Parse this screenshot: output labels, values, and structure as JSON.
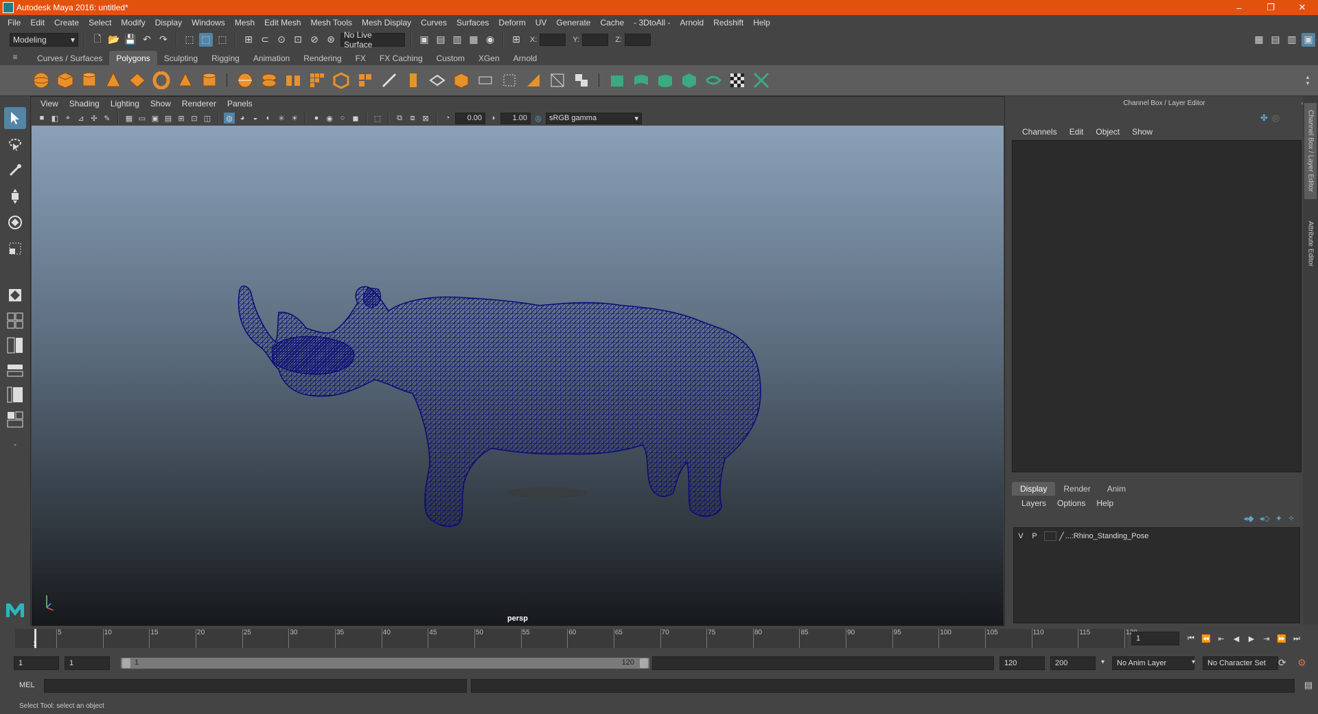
{
  "window": {
    "title": "Autodesk Maya 2016: untitled*",
    "controls": [
      "–",
      "❐",
      "✕"
    ]
  },
  "menubar": [
    "File",
    "Edit",
    "Create",
    "Select",
    "Modify",
    "Display",
    "Windows",
    "Mesh",
    "Edit Mesh",
    "Mesh Tools",
    "Mesh Display",
    "Curves",
    "Surfaces",
    "Deform",
    "UV",
    "Generate",
    "Cache",
    "- 3DtoAll -",
    "Arnold",
    "Redshift",
    "Help"
  ],
  "statusline": {
    "menuset": "Modeling",
    "live_surface": "No Live Surface",
    "x_label": "X:",
    "y_label": "Y:",
    "z_label": "Z:"
  },
  "shelf": {
    "tabs": [
      "Curves / Surfaces",
      "Polygons",
      "Sculpting",
      "Rigging",
      "Animation",
      "Rendering",
      "FX",
      "FX Caching",
      "Custom",
      "XGen",
      "Arnold"
    ],
    "active_tab": "Polygons"
  },
  "viewport": {
    "panel_menu": [
      "View",
      "Shading",
      "Lighting",
      "Show",
      "Renderer",
      "Panels"
    ],
    "exposure": "0.00",
    "gamma": "1.00",
    "color_space": "sRGB gamma",
    "camera": "persp",
    "wire_color": "#0a0a78"
  },
  "channel_box": {
    "header": "Channel Box / Layer Editor",
    "menu": [
      "Channels",
      "Edit",
      "Object",
      "Show"
    ]
  },
  "layer_editor": {
    "tabs": [
      "Display",
      "Render",
      "Anim"
    ],
    "active_tab": "Display",
    "menu": [
      "Layers",
      "Options",
      "Help"
    ],
    "layer": {
      "v": "V",
      "p": "P",
      "name": "...:Rhino_Standing_Pose"
    }
  },
  "side_tabs": {
    "channel_box": "Channel Box / Layer Editor",
    "attribute_editor": "Attribute Editor"
  },
  "timeslider": {
    "ticks": [
      "5",
      "10",
      "15",
      "20",
      "25",
      "30",
      "35",
      "40",
      "45",
      "50",
      "55",
      "60",
      "65",
      "70",
      "75",
      "80",
      "85",
      "90",
      "95",
      "100",
      "105",
      "110",
      "115",
      "120"
    ],
    "current_frame_label": "1",
    "current_frame": "1"
  },
  "rangeslider": {
    "start_time": "1",
    "playback_start": "1",
    "range_min_label": "1",
    "range_max_label": "120",
    "playback_end": "120",
    "end_time": "200",
    "anim_layer": "No Anim Layer",
    "character_set": "No Character Set"
  },
  "command_line": {
    "label": "MEL"
  },
  "help_line": "Select Tool: select an object"
}
